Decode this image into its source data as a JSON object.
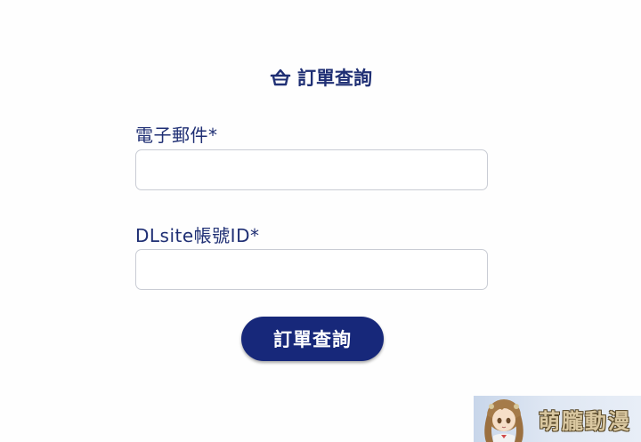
{
  "heading": {
    "title": "訂單查詢",
    "icon": "basket-icon"
  },
  "form": {
    "email_label": "電子郵件*",
    "email_value": "",
    "email_placeholder": "",
    "dlsite_label": "DLsite帳號ID*",
    "dlsite_value": "",
    "dlsite_placeholder": "",
    "submit_label": "訂單查詢"
  },
  "watermark": {
    "text": "萌朧動漫"
  },
  "colors": {
    "accent": "#1f2f74",
    "button": "#17287a",
    "input_border": "#c9ccd4"
  }
}
